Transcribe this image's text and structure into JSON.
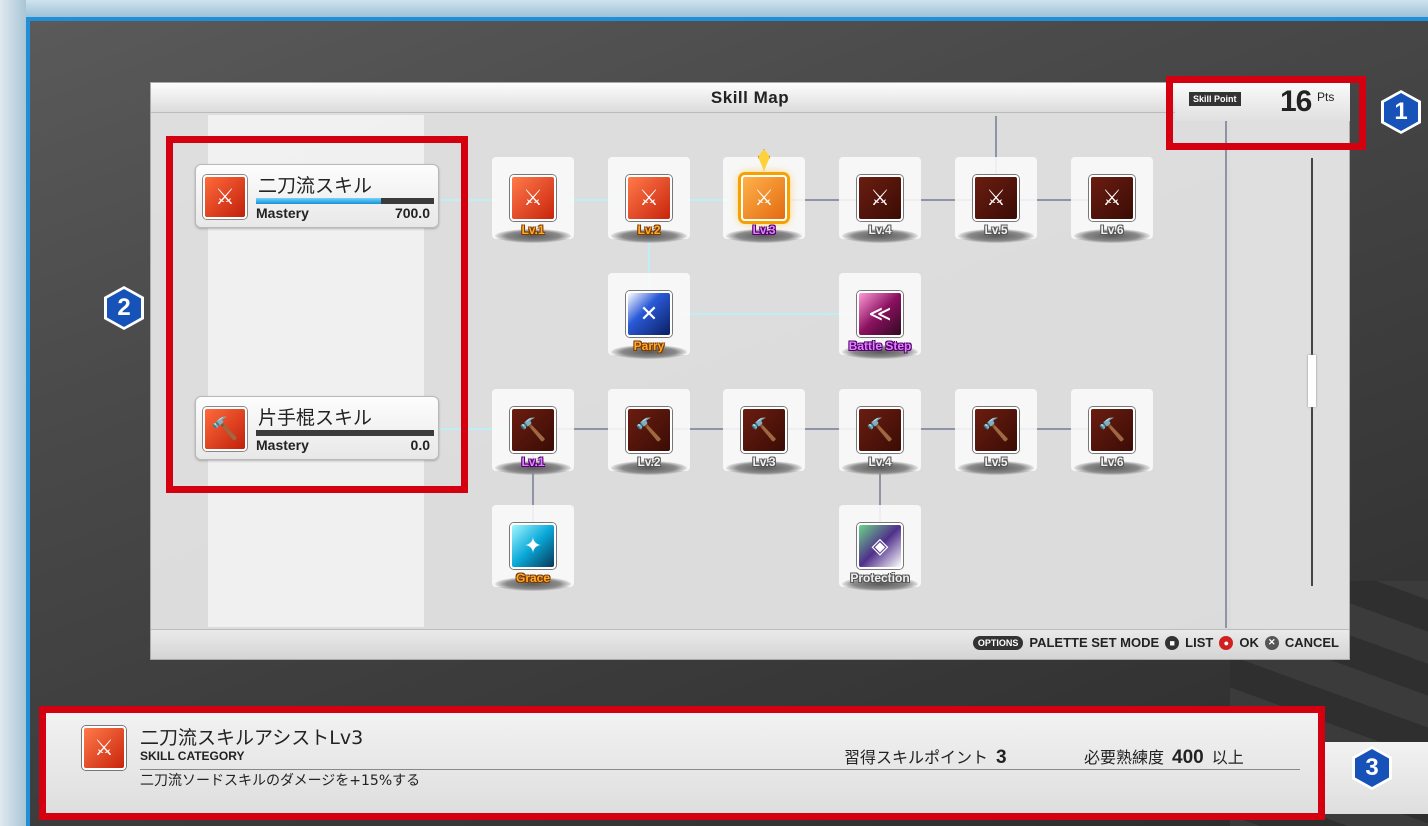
{
  "panel": {
    "title": "Skill Map",
    "skill_point_label": "Skill Point",
    "skill_point_value": "16",
    "skill_point_unit": "Pts"
  },
  "categories": [
    {
      "name": "二刀流スキル",
      "mastery_label": "Mastery",
      "mastery_value": "700.0",
      "mastery_fraction": 0.7
    },
    {
      "name": "片手棍スキル",
      "mastery_label": "Mastery",
      "mastery_value": "0.0",
      "mastery_fraction": 0.0
    }
  ],
  "row1": {
    "levels": [
      "Lv.1",
      "Lv.2",
      "Lv.3",
      "Lv.4",
      "Lv.5",
      "Lv.6"
    ],
    "extras": [
      "Parry",
      "Battle Step"
    ]
  },
  "row2": {
    "levels": [
      "Lv.1",
      "Lv.2",
      "Lv.3",
      "Lv.4",
      "Lv.5",
      "Lv.6"
    ],
    "extras": [
      "Grace",
      "Protection"
    ]
  },
  "footer": {
    "options_label": "OPTIONS",
    "palette_label": "PALETTE SET MODE",
    "list_label": "LIST",
    "ok_label": "OK",
    "cancel_label": "CANCEL"
  },
  "info": {
    "title": "二刀流スキルアシストLv3",
    "category": "SKILL CATEGORY",
    "description": "二刀流ソードスキルのダメージを+15%する",
    "req_points_label": "習得スキルポイント",
    "req_points_value": "3",
    "req_mastery_label": "必要熟練度",
    "req_mastery_value": "400",
    "req_mastery_suffix": "以上"
  },
  "badges": [
    "1",
    "2",
    "3"
  ],
  "colors": {
    "highlight": "#d40010",
    "badge": "#1652b8",
    "frame": "#1e8fd8"
  }
}
